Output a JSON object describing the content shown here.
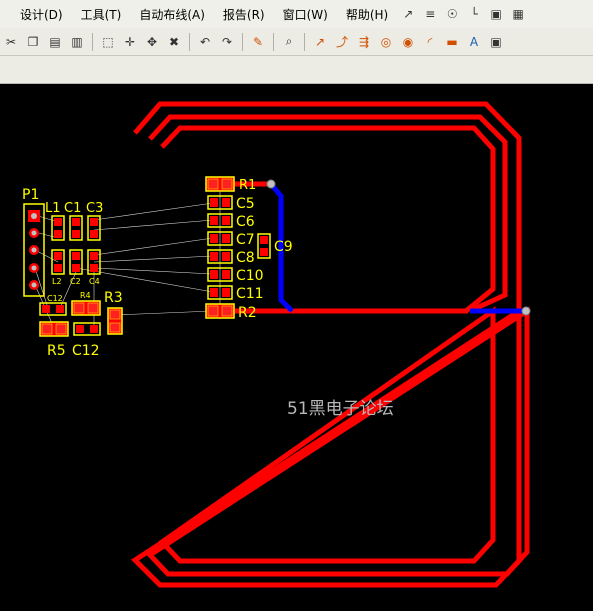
{
  "menu": {
    "items": [
      "设计(D)",
      "工具(T)",
      "自动布线(A)",
      "报告(R)",
      "窗口(W)",
      "帮助(H)"
    ]
  },
  "toolbar": {
    "icons": [
      "cut-icon",
      "copy-icon",
      "paste-icon",
      "rubber-stamp-icon",
      "select-area-icon",
      "move-icon",
      "cross-select-icon",
      "clear-icon",
      "undo-icon",
      "redo-icon",
      "brush-icon",
      "zoom-icon",
      "interactive-route-icon",
      "diff-pair-route-icon",
      "multi-route-icon",
      "via-icon",
      "pad-icon",
      "arc-icon",
      "fill-icon",
      "string-icon",
      "component-icon"
    ]
  },
  "pcb": {
    "watermark": "51黑电子论坛",
    "designators": [
      "R1",
      "C5",
      "C6",
      "C7",
      "C8",
      "C10",
      "C11",
      "R2",
      "C9",
      "P1",
      "L1",
      "C1",
      "C3",
      "L2",
      "C2",
      "C4",
      "C12",
      "R4",
      "R3",
      "R5",
      "C12"
    ],
    "colors": {
      "top_trace": "#ff0000",
      "bottom_trace": "#0000ff",
      "silkscreen": "#ffff00",
      "pad": "#ff0000",
      "background": "#000000"
    }
  }
}
